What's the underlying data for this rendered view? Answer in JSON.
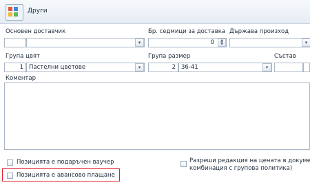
{
  "header": {
    "title": "Други",
    "icon": "grid-app-icon"
  },
  "fields": {
    "main_supplier": {
      "label": "Основен доставчик",
      "code": "",
      "value": ""
    },
    "delivery_weeks": {
      "label": "Бр. седмици за доставка",
      "value": "0"
    },
    "country_origin": {
      "label": "Държава произход",
      "value": ""
    },
    "color_group": {
      "label": "Група цвят",
      "code": "1",
      "value": "Пастелни цветове"
    },
    "size_group": {
      "label": "Група размер",
      "code": "2",
      "value": "36-41"
    },
    "composition": {
      "label": "Състав",
      "value": ""
    },
    "comment": {
      "label": "Коментар",
      "value": ""
    }
  },
  "checkboxes": {
    "gift_voucher": {
      "label": "Позицията е подаръчен ваучер",
      "checked": false
    },
    "advance_payment": {
      "label": "Позицията е авансово плащане",
      "checked": false,
      "highlighted": true
    },
    "allow_price_edit": {
      "label_line1": "Разреши редакция на цената в докуме",
      "label_line2": "комбинация с групова политика)",
      "checked": false
    }
  },
  "colors": {
    "highlight": "#e2202e",
    "header_bg": "#e6ecf4",
    "border": "#a9b6c6"
  }
}
